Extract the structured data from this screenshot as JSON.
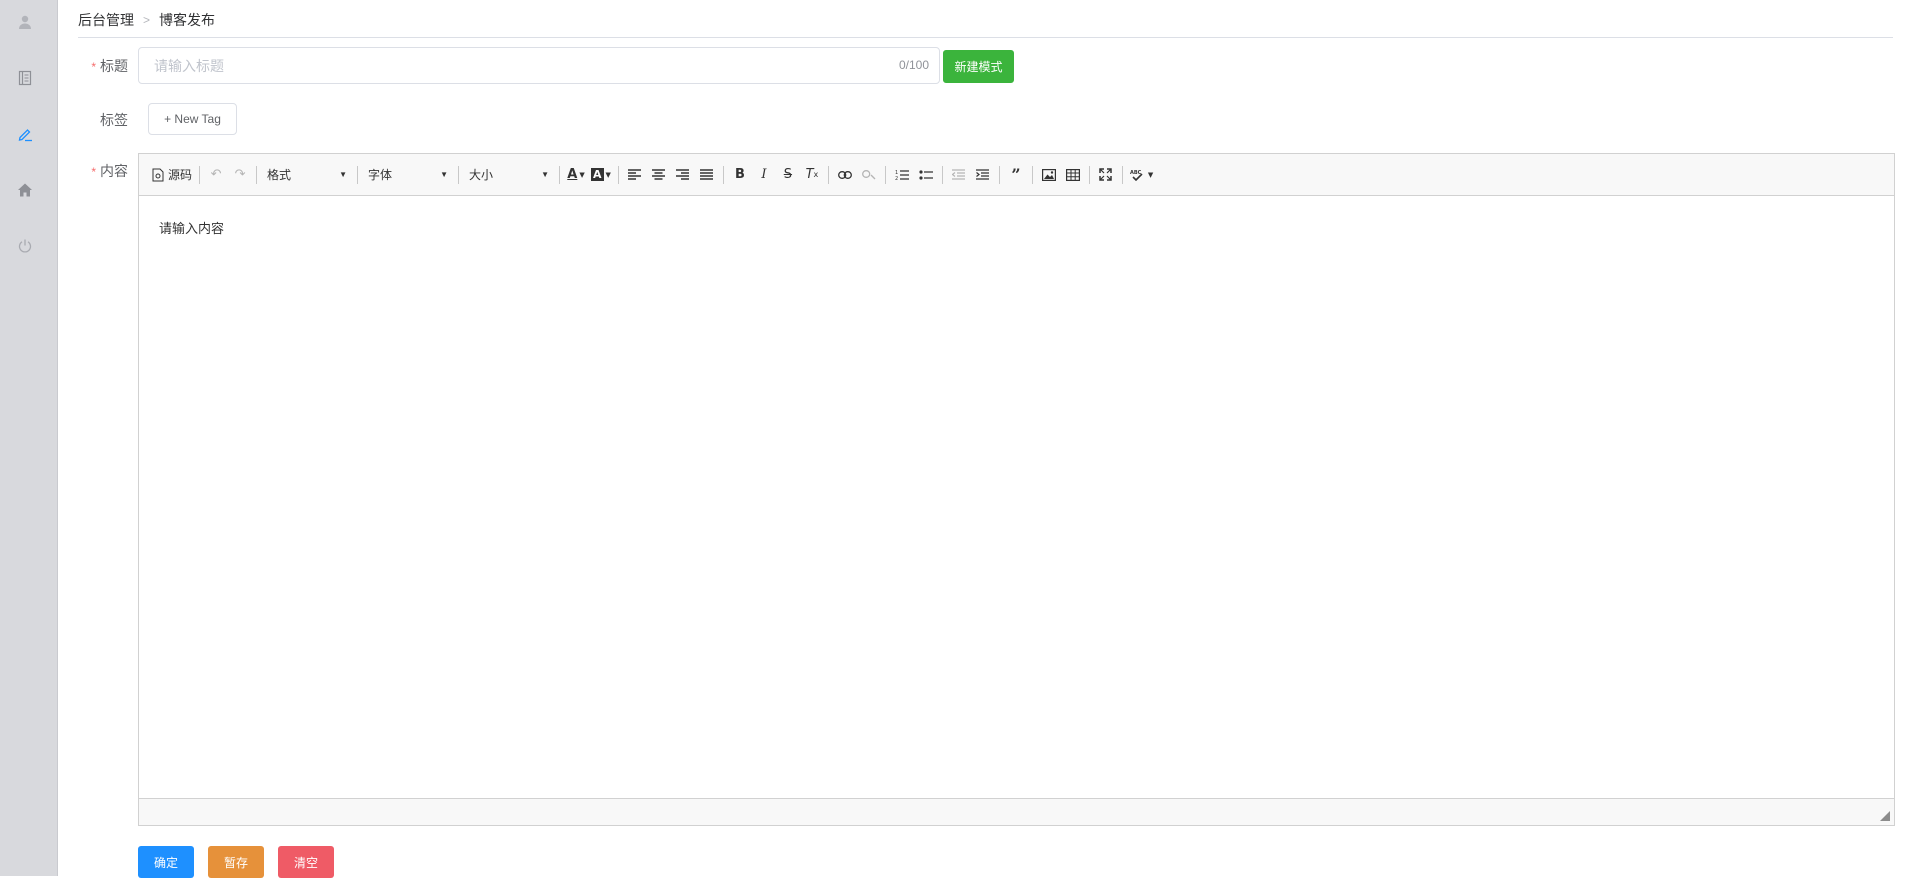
{
  "breadcrumb": {
    "root": "后台管理",
    "current": "博客发布"
  },
  "sidebar": {
    "items": [
      {
        "icon": "user-icon"
      },
      {
        "icon": "document-icon"
      },
      {
        "icon": "edit-icon",
        "active": true
      },
      {
        "icon": "home-icon"
      },
      {
        "icon": "power-icon"
      }
    ],
    "active_color": "#1e90ff"
  },
  "form": {
    "title_label": "标题",
    "title_placeholder": "请输入标题",
    "title_count": "0/100",
    "new_mode_button": "新建模式",
    "tag_label": "标签",
    "new_tag_button": "+ New Tag",
    "content_label": "内容"
  },
  "editor": {
    "toolbar": {
      "source_label": "源码",
      "format_label": "格式",
      "font_label": "字体",
      "size_label": "大小"
    },
    "placeholder": "请输入内容"
  },
  "actions": {
    "confirm": "确定",
    "draft": "暂存",
    "clear": "清空"
  },
  "colors": {
    "green": "#3bb43c",
    "blue": "#1e90ff",
    "orange": "#e6913a",
    "red": "#ef5b66"
  }
}
